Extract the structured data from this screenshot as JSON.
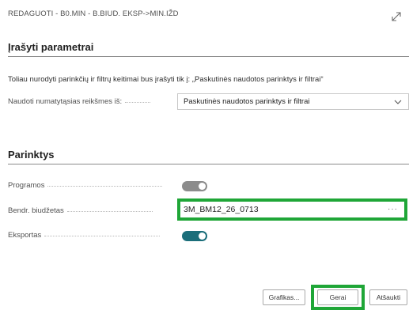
{
  "header": {
    "title": "REDAGUOTI - B0.MIN - B.BIUD. EKSP->MIN.IŽD"
  },
  "section1": {
    "title": "Įrašyti parametrai",
    "info": "Toliau nurodyti parinkčių ir filtrų keitimai bus įrašyti tik į: „Paskutinės naudotos parinktys ir filtrai“",
    "defaults_label": "Naudoti numatytąsias reikšmes iš:",
    "defaults_value": "Paskutinės naudotos parinktys ir filtrai"
  },
  "section2": {
    "title": "Parinktys",
    "programos_label": "Programos",
    "programos_on": false,
    "budget_label": "Bendr. biudžetas",
    "budget_value": "3M_BM12_26_0713",
    "more_label": "···",
    "eksportas_label": "Eksportas",
    "eksportas_on": true
  },
  "footer": {
    "graphics_label": "Grafikas...",
    "ok_label": "Gerai",
    "cancel_label": "Atšaukti"
  },
  "colors": {
    "highlight": "#1fa637",
    "toggle_on": "#1b6e7a",
    "toggle_off": "#8c8c8c"
  },
  "icons": [
    "expand-icon",
    "chevron-down-icon"
  ]
}
